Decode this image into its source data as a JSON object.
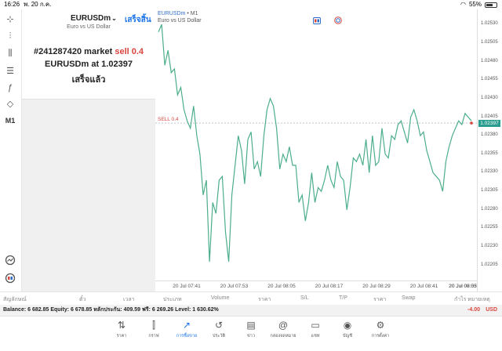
{
  "status_bar": {
    "time": "16:26",
    "date": "พ. 20 ก.ค.",
    "battery": "55%"
  },
  "left_toolbar": {
    "items": [
      {
        "name": "crosshair-icon",
        "glyph": "⊹"
      },
      {
        "name": "chart-type-icon",
        "glyph": "⫶"
      },
      {
        "name": "indicators-icon",
        "glyph": "⫼"
      },
      {
        "name": "settings-sliders-icon",
        "glyph": "☰"
      },
      {
        "name": "function-icon",
        "glyph": "ƒ"
      },
      {
        "name": "objects-icon",
        "glyph": "◇"
      },
      {
        "name": "timeframe-label",
        "glyph": "M1"
      }
    ]
  },
  "order_panel": {
    "symbol": "EURUSDm",
    "done_label": "เสร็จสิ้น",
    "symbol_desc": "Euro vs US Dollar",
    "line1_prefix": "#241287420 market ",
    "line1_sell": "sell 0.4",
    "line2": "EURUSDm at 1.02397",
    "line3": "เสร็จแล้ว"
  },
  "chart": {
    "symbol": "EURUSDm",
    "timeframe": "• M1",
    "description": "Euro vs US Dollar",
    "current_price": "1.02397",
    "sell_label": "SELL 0.4",
    "price_ticks": [
      "1.02530",
      "1.02505",
      "1.02480",
      "1.02455",
      "1.02430",
      "1.02405",
      "1.02380",
      "1.02355",
      "1.02330",
      "1.02305",
      "1.02280",
      "1.02255",
      "1.02230",
      "1.02205"
    ],
    "time_ticks": [
      "20 Jul 07:41",
      "20 Jul 07:53",
      "20 Jul 08:05",
      "20 Jul 08:17",
      "20 Jul 08:29",
      "20 Jul 08:41",
      "20 Jul 08:53",
      "20 Jul 09:05"
    ],
    "line_color": "#4cae8a",
    "sell_color": "#d9463e"
  },
  "chart_data": {
    "type": "line",
    "title": "",
    "series": [
      {
        "values": [
          1.0252,
          1.0253,
          1.02475,
          1.02495,
          1.02465,
          1.0247,
          1.02435,
          1.02445,
          1.02415,
          1.024,
          1.0239,
          1.0242,
          1.0238,
          1.02355,
          1.023,
          1.0232,
          1.0221,
          1.0229,
          1.02275,
          1.0232,
          1.02325,
          1.0225,
          1.0221,
          1.023,
          1.0234,
          1.0238,
          1.0236,
          1.02315,
          1.02375,
          1.02385,
          1.02335,
          1.02345,
          1.02325,
          1.0238,
          1.02415,
          1.0243,
          1.0242,
          1.0239,
          1.02335,
          1.02355,
          1.02345,
          1.02365,
          1.0234,
          1.0234,
          1.0229,
          1.023,
          1.02265,
          1.0229,
          1.0233,
          1.0229,
          1.0231,
          1.02305,
          1.0232,
          1.0234,
          1.0232,
          1.0231,
          1.02345,
          1.02325,
          1.0232,
          1.0228,
          1.0231,
          1.0235,
          1.02345,
          1.02355,
          1.0234,
          1.02375,
          1.0233,
          1.0238,
          1.0234,
          1.02345,
          1.0239,
          1.02355,
          1.0235,
          1.0238,
          1.02375,
          1.02395,
          1.024,
          1.02385,
          1.0237,
          1.02405,
          1.02415,
          1.024,
          1.0238,
          1.02385,
          1.0236,
          1.02345,
          1.0233,
          1.02325,
          1.0232,
          1.02305,
          1.02345,
          1.02365,
          1.0238,
          1.0239,
          1.024,
          1.02395,
          1.0241,
          1.02405,
          1.024
        ]
      }
    ],
    "x_ticks": [
      "20 Jul 07:41",
      "20 Jul 07:53",
      "20 Jul 08:05",
      "20 Jul 08:17",
      "20 Jul 08:29",
      "20 Jul 08:41",
      "20 Jul 08:53",
      "20 Jul 09:05"
    ],
    "ylim": [
      1.0219,
      1.02545
    ],
    "sell_level": 1.02397,
    "grid": false
  },
  "table_header": [
    "สัญลักษณ์",
    "ตั๋ว",
    "เวลา",
    "ประเภท",
    "Volume",
    "ราคา",
    "S/L",
    "T/P",
    "ราคา",
    "Swap",
    "กำไร",
    "หมายเหตุ"
  ],
  "balance_bar": {
    "text": "Balance: 6 682.85 Equity: 6 678.85 หลักประกัน: 409.59 ฟรี: 6 269.26 Level: 1 630.62%",
    "profit": "-4.00",
    "currency": "USD"
  },
  "bottom_nav": [
    {
      "name": "nav-quotes",
      "icon": "⇅",
      "label": "ราคา"
    },
    {
      "name": "nav-charts",
      "icon": "⫿",
      "label": "กราฟ"
    },
    {
      "name": "nav-trade",
      "icon": "↗",
      "label": "การซื้อขาย",
      "active": true
    },
    {
      "name": "nav-history",
      "icon": "↺",
      "label": "ประวัติ"
    },
    {
      "name": "nav-news",
      "icon": "▤",
      "label": "ข่าว"
    },
    {
      "name": "nav-mailbox",
      "icon": "@",
      "label": "กล่องจดหมาย"
    },
    {
      "name": "nav-chat",
      "icon": "▭",
      "label": "แชท"
    },
    {
      "name": "nav-account",
      "icon": "◉",
      "label": "บัญชี"
    },
    {
      "name": "nav-settings",
      "icon": "⚙",
      "label": "การตั้งค่า"
    }
  ]
}
